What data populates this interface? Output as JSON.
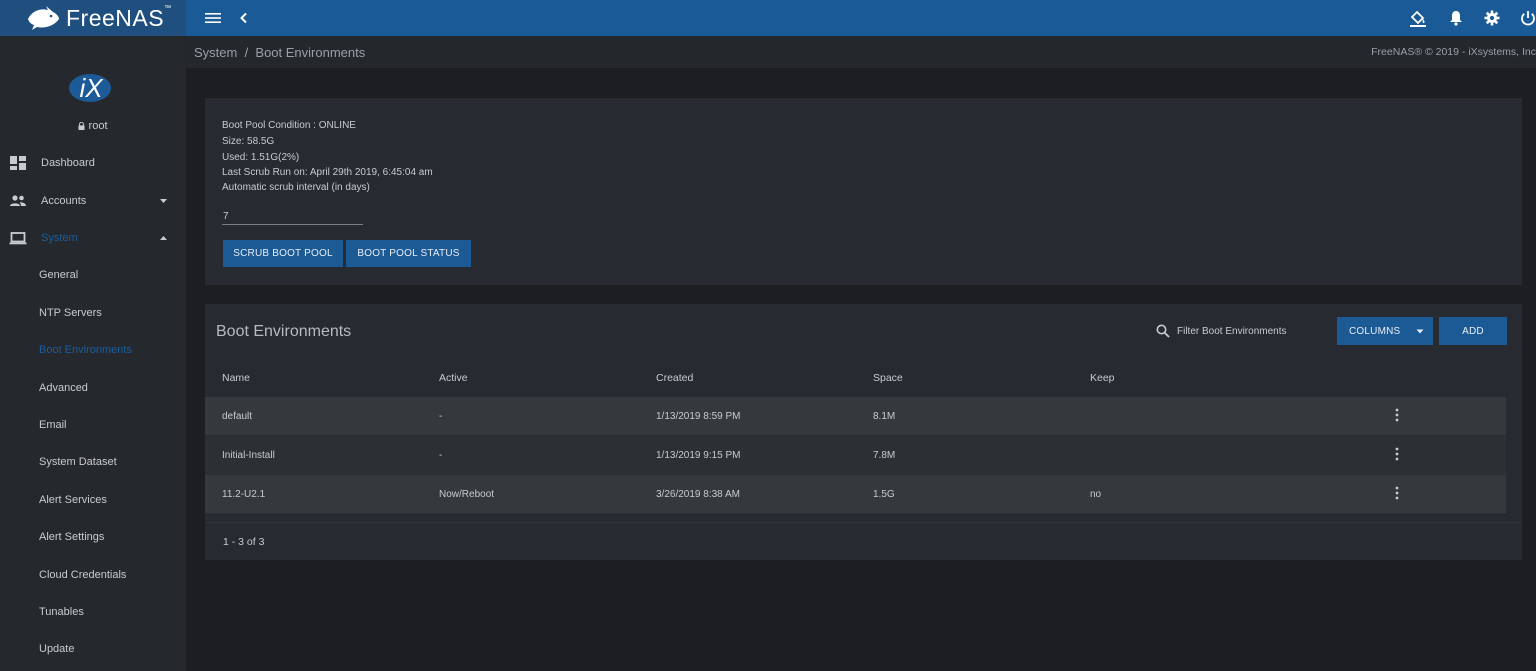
{
  "app": {
    "logo_text": "FreeNAS",
    "tm": "™"
  },
  "topbar": {
    "icons": [
      "menu-icon",
      "chevron-left-icon",
      "update-icon",
      "bell-icon",
      "gear-icon",
      "power-icon"
    ]
  },
  "breadcrumb": "System  /  Boot Environments",
  "copyright": "FreeNAS® © 2019 - iXsystems, Inc",
  "sidebar": {
    "avatar_text": "iX",
    "user": "root",
    "items": [
      {
        "label": "Dashboard",
        "icon": "dashboard-icon"
      },
      {
        "label": "Accounts",
        "icon": "accounts-icon"
      },
      {
        "label": "System",
        "icon": "laptop-icon"
      }
    ],
    "sub_items": [
      {
        "label": "General"
      },
      {
        "label": "NTP Servers"
      },
      {
        "label": "Boot Environments"
      },
      {
        "label": "Advanced"
      },
      {
        "label": "Email"
      },
      {
        "label": "System Dataset"
      },
      {
        "label": "Alert Services"
      },
      {
        "label": "Alert Settings"
      },
      {
        "label": "Cloud Credentials"
      },
      {
        "label": "Tunables"
      },
      {
        "label": "Update"
      }
    ]
  },
  "boot_pool": {
    "condition": "Boot Pool Condition : ONLINE",
    "size": "Size: 58.5G",
    "used": "Used: 1.51G(2%)",
    "last_scrub": "Last Scrub Run on: April 29th 2019, 6:45:04 am",
    "interval_label": "Automatic scrub interval (in days)",
    "interval_value": "7",
    "scrub_button": "SCRUB BOOT POOL",
    "status_button": "BOOT POOL STATUS"
  },
  "table": {
    "title": "Boot Environments",
    "filter_placeholder": "Filter Boot Environments",
    "columns_button": "COLUMNS",
    "add_button": "ADD",
    "headers": [
      "Name",
      "Active",
      "Created",
      "Space",
      "Keep"
    ],
    "rows": [
      {
        "name": "default",
        "active": "-",
        "created": "1/13/2019 8:59 PM",
        "space": "8.1M",
        "keep": ""
      },
      {
        "name": "Initial-Install",
        "active": "-",
        "created": "1/13/2019 9:15 PM",
        "space": "7.8M",
        "keep": ""
      },
      {
        "name": "11.2-U2.1",
        "active": "Now/Reboot",
        "created": "3/26/2019 8:38 AM",
        "space": "1.5G",
        "keep": "no"
      }
    ],
    "pager": "1 - 3 of 3"
  }
}
